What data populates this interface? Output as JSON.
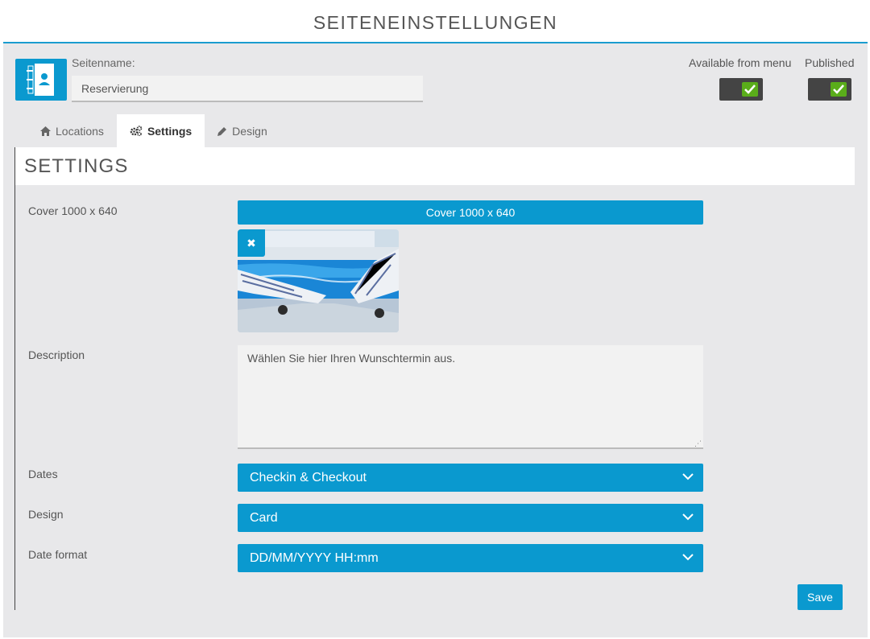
{
  "header": {
    "title": "SEITENEINSTELLUNGEN"
  },
  "page": {
    "name_label": "Seitenname:",
    "name_value": "Reservierung"
  },
  "toggles": {
    "menu_label": "Available from menu",
    "menu_checked": true,
    "published_label": "Published",
    "published_checked": true
  },
  "tabs": [
    {
      "label": "Locations",
      "icon": "home-icon"
    },
    {
      "label": "Settings",
      "icon": "gears-icon",
      "active": true
    },
    {
      "label": "Design",
      "icon": "pencil-icon"
    }
  ],
  "settings": {
    "title": "SETTINGS",
    "cover_label": "Cover 1000 x 640",
    "cover_button": "Cover 1000 x 640",
    "description_label": "Description",
    "description_value": "Wählen Sie hier Ihren Wunschtermin aus.",
    "dates_label": "Dates",
    "dates_value": "Checkin & Checkout",
    "design_label": "Design",
    "design_value": "Card",
    "date_format_label": "Date format",
    "date_format_value": "DD/MM/YYYY HH:mm",
    "save_button": "Save"
  },
  "colors": {
    "accent": "#0a99cf",
    "toggle_on": "#5aad1a",
    "toggle_bg": "#444444"
  }
}
